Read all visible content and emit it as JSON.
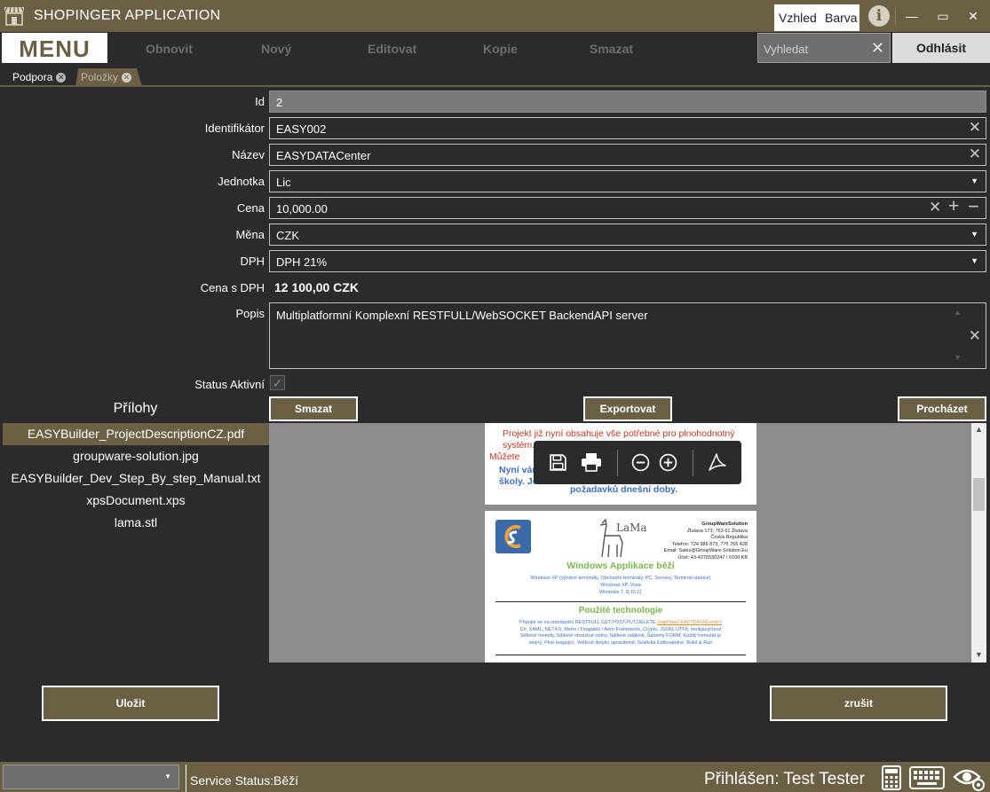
{
  "window": {
    "title": "SHOPINGER APPLICATION",
    "style_label": "Vzhled",
    "color_label": "Barva",
    "info_glyph": "i",
    "minimize_glyph": "—",
    "maximize_glyph": "▭",
    "close_glyph": "✕"
  },
  "toolbar": {
    "menu_label": "MENU",
    "refresh_label": "Obnovit",
    "new_label": "Nový",
    "edit_label": "Editovat",
    "copy_label": "Kopie",
    "delete_label": "Smazat",
    "search_placeholder": "Vyhledat",
    "logout_label": "Odhlásit"
  },
  "tabs": [
    {
      "label": "Podpora",
      "active": false
    },
    {
      "label": "Položky",
      "active": true
    }
  ],
  "form": {
    "id": {
      "label": "Id",
      "value": "2"
    },
    "identifier": {
      "label": "Identifikátor",
      "value": "EASY002"
    },
    "name": {
      "label": "Název",
      "value": "EASYDATACenter"
    },
    "unit": {
      "label": "Jednotka",
      "value": "Lic"
    },
    "price": {
      "label": "Cena",
      "value": "10,000.00"
    },
    "currency": {
      "label": "Měna",
      "value": "CZK"
    },
    "vat": {
      "label": "DPH",
      "value": "DPH 21%"
    },
    "price_vat": {
      "label": "Cena s DPH",
      "value": "12 100,00 CZK"
    },
    "description": {
      "label": "Popis",
      "value": "Multiplatformní Komplexní RESTFULL/WebSOCKET BackendAPI server"
    },
    "status": {
      "label": "Status Aktivní",
      "checked": true
    }
  },
  "attachments": {
    "title": "Přílohy",
    "delete_label": "Smazat",
    "export_label": "Exportovat",
    "browse_label": "Procházet",
    "files": [
      "EASYBuilder_ProjectDescriptionCZ.pdf",
      "groupware-solution.jpg",
      "EASYBuilder_Dev_Step_By_step_Manual.txt",
      "xpsDocument.xps",
      "lama.stl"
    ]
  },
  "preview": {
    "page1": {
      "line1": "Projekt již nyní obsahuje vše potřebné pro plnohodnotný",
      "line2": "systém.",
      "line3": "Můžete",
      "line4": "Nyní vám",
      "line5": "školy. Je",
      "line6": "požadavků dnešní doby."
    },
    "page2": {
      "company": "GroupWareSolution",
      "address1": "Žlutava 173; 763 61 Žlutava",
      "address2": "Česká Republika",
      "phone": "Telefon: 724 986 873, 776 765 428",
      "email": "Email: Sales@GroupWare-Solution.Eu",
      "account": "Účet: 43-4376530247 / 0100 KB",
      "heading1": "Windows Applikace běží",
      "text1a": "Windows XP (výrobní terminály, Obchodní terminály, PC, Servery, Terminál stanice)",
      "text1b": "Windows XP, Vista",
      "text1c": "Windows 7, 8,10,11",
      "heading2": "Použité technologie",
      "text2a": "Připojte se na standardní RESTFULL GET,POST,PUT,DELETE",
      "text2link": "(například EASYDATACenter)",
      "text2b": "C#, XAML, NET4.5, Metro / Dragablz / Aero Framework, Crypto, JSON, UTF8, multijazyčnost",
      "text2c": "Sdílené metody, Sdílené obslužné rutiny, Sdílené události, Šablony FORM, Každý formulář je",
      "text2d": "stejný, Plně reagující, Velikost dotyku upravitelné, Grafická Editovatelné, Build & Run",
      "logo_text": "LaMa"
    }
  },
  "buttons": {
    "save_label": "Uložit",
    "cancel_label": "zrušit"
  },
  "statusbar": {
    "service_label": "Service Status:",
    "service_value": "Běží",
    "logged_text": "Přihlášen: Test Tester"
  },
  "colors": {
    "accent": "#6b5f44",
    "background": "#2b2b2b",
    "preview_bg": "#8c8c8c",
    "heading_green": "#7ab648",
    "text_blue": "#3d6fc4",
    "text_red": "#c8361f"
  },
  "icons": {
    "app": "shop-icon",
    "calculator": "calculator-icon",
    "keyboard": "keyboard-icon",
    "visibility": "eye-settings-icon"
  }
}
